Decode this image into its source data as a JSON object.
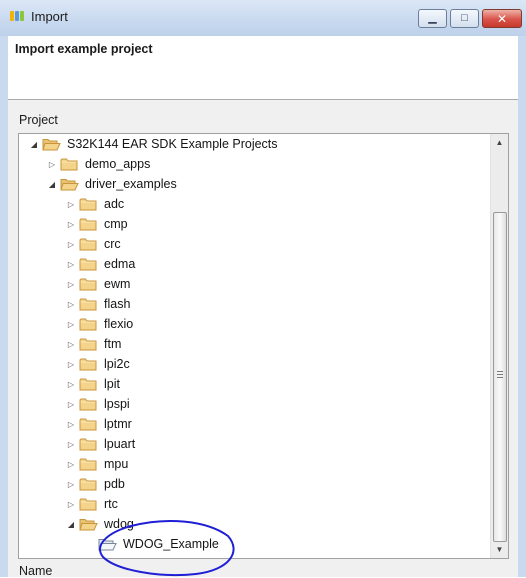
{
  "window": {
    "title": "Import",
    "icon": "nxp-logo-icon",
    "controls": [
      "minimize",
      "maximize",
      "close"
    ]
  },
  "header": {
    "title": "Import example project"
  },
  "project_label": "Project",
  "name_label": "Name",
  "tree": {
    "root": "S32K144 EAR SDK Example Projects",
    "demo": "demo_apps",
    "driver": "driver_examples",
    "drivers": [
      "adc",
      "cmp",
      "crc",
      "edma",
      "ewm",
      "flash",
      "flexio",
      "ftm",
      "lpi2c",
      "lpit",
      "lpspi",
      "lptmr",
      "lpuart",
      "mpu",
      "pdb",
      "rtc"
    ],
    "wdog": "wdog",
    "wdog_child": "WDOG_Example"
  },
  "colors": {
    "folder_fill": "#f4d38a",
    "folder_stroke": "#c9953a",
    "annotation": "#1f1fd6",
    "titlebar": "#c8d9ef"
  }
}
